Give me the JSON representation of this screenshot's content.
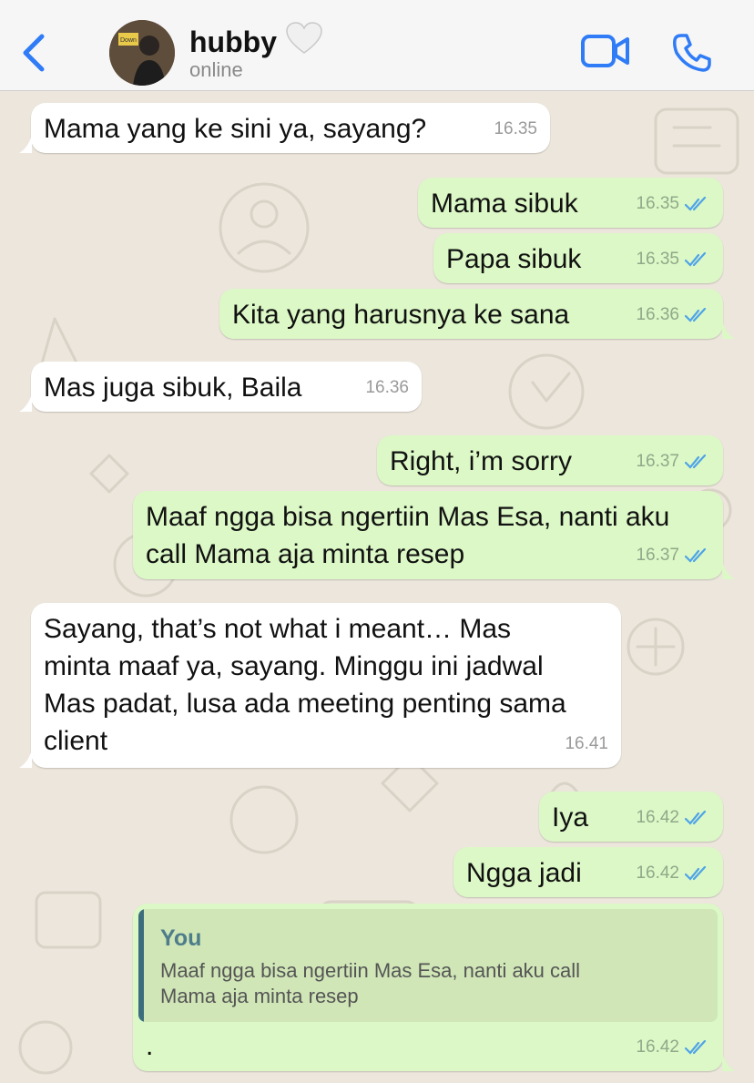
{
  "header": {
    "contact_name": "hubby",
    "contact_emoji": "🤍",
    "status": "online",
    "icons": [
      "back-chevron-icon",
      "video-camera-icon",
      "phone-icon"
    ],
    "avatar_text": "Down"
  },
  "colors": {
    "accent": "#2f7cf6",
    "incoming_bubble": "#ffffff",
    "outgoing_bubble": "#dcf8c6",
    "read_ticks": "#4fa3e8",
    "quote_bar": "#3b6d7d"
  },
  "messages": [
    {
      "dir": "in",
      "text": "Mama yang ke sini ya, sayang?",
      "time": "16.35"
    },
    {
      "dir": "out",
      "text": "Mama sibuk",
      "time": "16.35"
    },
    {
      "dir": "out",
      "text": "Papa sibuk",
      "time": "16.35"
    },
    {
      "dir": "out",
      "text": "Kita yang harusnya ke sana",
      "time": "16.36"
    },
    {
      "dir": "in",
      "text": "Mas juga sibuk, Baila",
      "time": "16.36"
    },
    {
      "dir": "out",
      "text": "Right, i’m sorry",
      "time": "16.37"
    },
    {
      "dir": "out",
      "lines": [
        "Maaf ngga bisa ngertiin Mas Esa, nanti aku",
        "call Mama aja minta resep"
      ],
      "time": "16.37"
    },
    {
      "dir": "in",
      "lines": [
        "Sayang, that’s not what i meant… Mas",
        "minta maaf ya, sayang. Minggu ini jadwal",
        "Mas padat, lusa ada meeting penting sama",
        "client"
      ],
      "time": "16.41"
    },
    {
      "dir": "out",
      "text": "Iya",
      "time": "16.42"
    },
    {
      "dir": "out",
      "text": "Ngga jadi",
      "time": "16.42"
    },
    {
      "dir": "out",
      "text": ".",
      "time": "16.42",
      "quote": {
        "author": "You",
        "lines": [
          "Maaf ngga bisa ngertiin Mas Esa, nanti aku call",
          "Mama aja minta resep"
        ]
      }
    }
  ]
}
